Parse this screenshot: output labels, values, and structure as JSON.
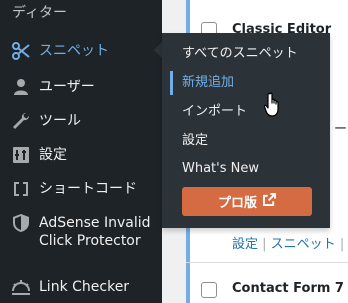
{
  "sidebar": {
    "top_label": "ディター",
    "items": [
      {
        "label": "スニペット",
        "icon": "scissors-icon",
        "current": true
      },
      {
        "label": "ユーザー",
        "icon": "user-icon"
      },
      {
        "label": "ツール",
        "icon": "wrench-icon"
      },
      {
        "label": "設定",
        "icon": "settings-icon"
      },
      {
        "label": "ショートコード",
        "icon": "shortcode-icon"
      },
      {
        "label": "AdSense Invalid\nClick Protector",
        "line1": "AdSense Invalid",
        "line2": "Click Protector",
        "icon": "shield-icon"
      },
      {
        "label": "Link Checker",
        "icon": "link-checker-icon"
      }
    ]
  },
  "flyout": {
    "items": [
      {
        "label": "すべてのスニペット"
      },
      {
        "label": "新規追加",
        "active": true
      },
      {
        "label": "インポート"
      },
      {
        "label": "設定"
      },
      {
        "label": "What's New"
      }
    ],
    "pro_button": {
      "label": "プロ版",
      "icon": "external-link-icon",
      "color": "#d46b42"
    }
  },
  "content": {
    "rows": [
      {
        "title": "Classic Editor"
      },
      {
        "title": "Contact Form 7"
      }
    ],
    "row_actions": {
      "settings": "設定",
      "snippets": "スニペット"
    }
  },
  "colors": {
    "sidebar_bg": "#1d2327",
    "flyout_bg": "#2c3338",
    "accent": "#72aee6"
  }
}
